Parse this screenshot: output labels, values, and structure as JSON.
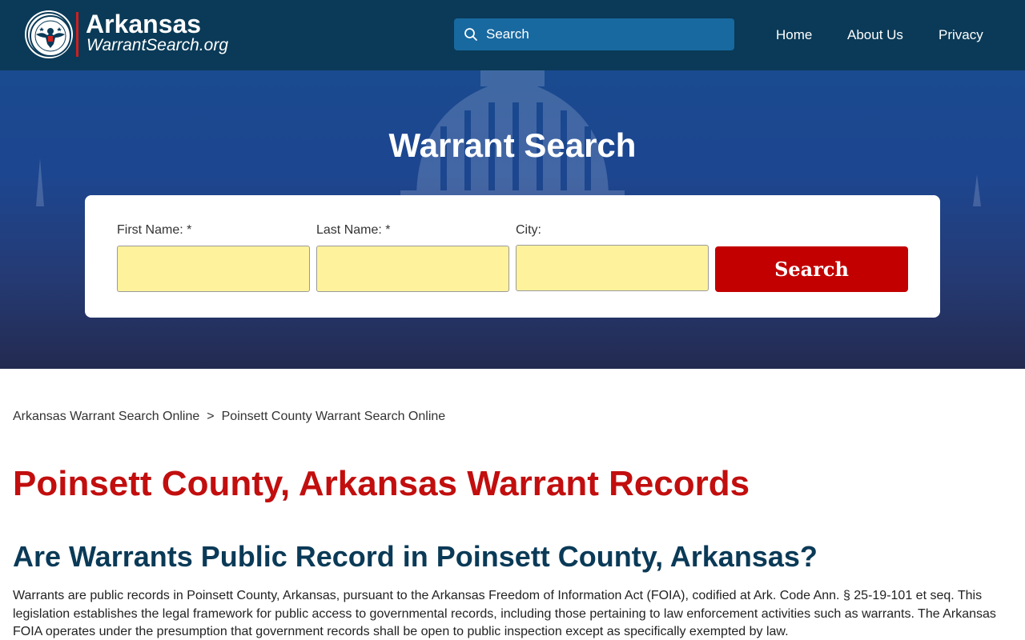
{
  "header": {
    "logo_title": "Arkansas",
    "logo_subtitle": "WarrantSearch.org",
    "logo_badge_text": "WARRANT SEARCH",
    "search_placeholder": "Search",
    "nav": [
      {
        "label": "Home"
      },
      {
        "label": "About Us"
      },
      {
        "label": "Privacy"
      }
    ]
  },
  "hero": {
    "title": "Warrant Search",
    "form": {
      "first_name_label": "First Name: *",
      "last_name_label": "Last Name: *",
      "city_label": "City:",
      "first_name_value": "",
      "last_name_value": "",
      "city_value": "",
      "submit_label": "Search"
    }
  },
  "breadcrumb": {
    "items": [
      {
        "label": "Arkansas Warrant Search Online"
      },
      {
        "label": "Poinsett County Warrant Search Online"
      }
    ],
    "separator": ">"
  },
  "content": {
    "page_title": "Poinsett County, Arkansas Warrant Records",
    "section_heading": "Are Warrants Public Record in Poinsett County, Arkansas?",
    "paragraph": "Warrants are public records in Poinsett County, Arkansas, pursuant to the Arkansas Freedom of Information Act (FOIA), codified at Ark. Code Ann. § 25-19-101 et seq. This legislation establishes the legal framework for public access to governmental records, including those pertaining to law enforcement activities such as warrants. The Arkansas FOIA operates under the presumption that government records shall be open to public inspection except as specifically exempted by law."
  },
  "colors": {
    "header_bg": "#0a3a57",
    "search_bg": "#1869a0",
    "accent_red": "#c20000",
    "title_red": "#c20e0e",
    "heading_navy": "#0a3a57",
    "input_fill": "#fff29c"
  },
  "icons": {
    "logo": "eagle-badge-icon",
    "search": "search-icon"
  }
}
